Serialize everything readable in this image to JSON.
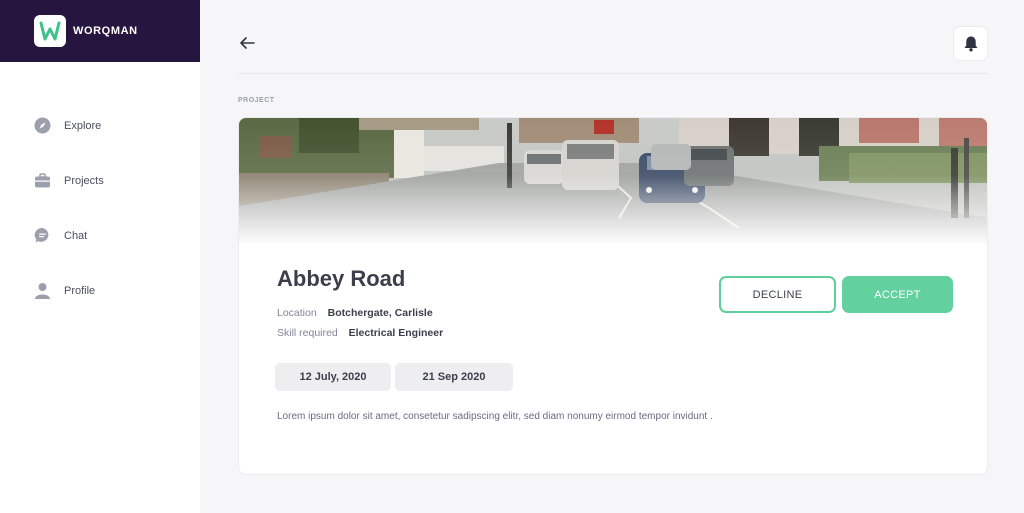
{
  "app": {
    "name": "WORQMAN",
    "logo_letter": "W"
  },
  "sidebar": {
    "items": [
      {
        "label": "Explore",
        "icon": "compass-icon"
      },
      {
        "label": "Projects",
        "icon": "briefcase-icon"
      },
      {
        "label": "Chat",
        "icon": "chat-icon"
      },
      {
        "label": "Profile",
        "icon": "user-icon"
      }
    ]
  },
  "header": {
    "back_icon": "arrow-left-icon",
    "notification_icon": "bell-icon"
  },
  "section_label": "PROJECT",
  "project": {
    "title": "Abbey Road",
    "location_label": "Location",
    "location": "Botchergate, Carlisle",
    "skill_label": "Skill required",
    "skill": "Electrical Engineer",
    "start_date": "12 July, 2020",
    "end_date": "21 Sep 2020",
    "description": "Lorem ipsum dolor sit amet, consetetur sadipscing elitr, sed diam nonumy eirmod tempor invidunt ."
  },
  "actions": {
    "decline_label": "DECLINE",
    "accept_label": "ACCEPT"
  },
  "colors": {
    "brand_dark": "#26163f",
    "accent_green": "#63d09f",
    "logo_green": "#3ec28a"
  }
}
